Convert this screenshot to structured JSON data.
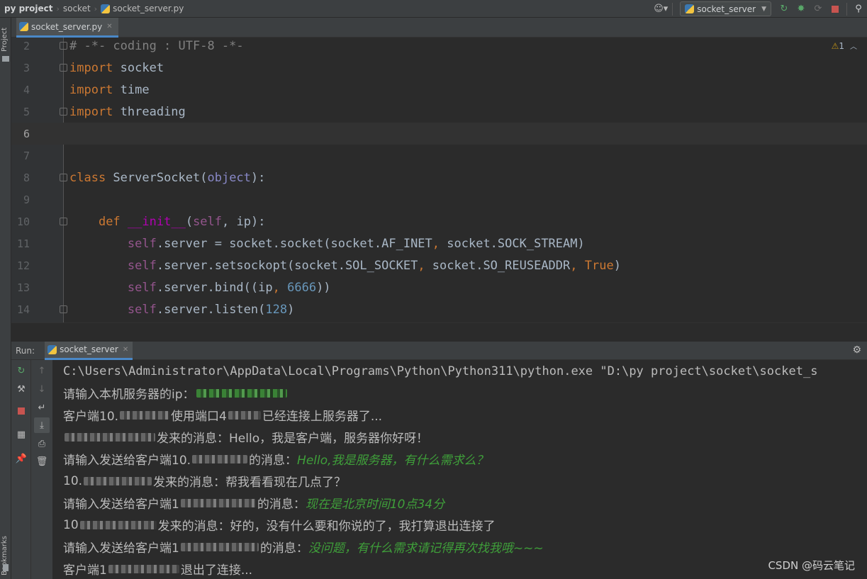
{
  "navbar": {
    "project": "py project",
    "folder": "socket",
    "file": "socket_server.py",
    "run_config": "socket_server"
  },
  "left_strip": {
    "project_tab": "Project",
    "bookmarks_tab": "Bookmarks"
  },
  "editor": {
    "tab_label": "socket_server.py",
    "warning_count": "1",
    "lines": [
      {
        "n": "2",
        "html": "<span class=\"cm\"># -*- coding : UTF-8 -*-</span>"
      },
      {
        "n": "3",
        "html": "<span class=\"kw\">import</span> socket"
      },
      {
        "n": "4",
        "html": "<span class=\"kw\">import</span> time"
      },
      {
        "n": "5",
        "html": "<span class=\"kw\">import</span> threading"
      },
      {
        "n": "6",
        "html": ""
      },
      {
        "n": "7",
        "html": ""
      },
      {
        "n": "8",
        "html": "<span class=\"kw\">class</span> ServerSocket(<span class=\"builtin\">object</span>):"
      },
      {
        "n": "9",
        "html": ""
      },
      {
        "n": "10",
        "html": "    <span class=\"kw\">def</span> <span class=\"magic\">__init__</span>(<span class=\"self\">self</span>, ip):"
      },
      {
        "n": "11",
        "html": "        <span class=\"self\">self</span>.server = socket.socket(socket.AF_INET<span class=\"kw\">,</span> socket.SOCK_STREAM)"
      },
      {
        "n": "12",
        "html": "        <span class=\"self\">self</span>.server.setsockopt(socket.SOL_SOCKET<span class=\"kw\">,</span> socket.SO_REUSEADDR<span class=\"kw\">,</span> <span class=\"kw\">True</span>)"
      },
      {
        "n": "13",
        "html": "        <span class=\"self\">self</span>.server.bind((ip<span class=\"kw\">,</span> <span class=\"num\">6666</span>))"
      },
      {
        "n": "14",
        "html": "        <span class=\"self\">self</span>.server.listen(<span class=\"num\">128</span>)"
      }
    ]
  },
  "run": {
    "label": "Run:",
    "tab": "socket_server"
  },
  "console": {
    "line1": "C:\\Users\\Administrator\\AppData\\Local\\Programs\\Python\\Python311\\python.exe \"D:\\py project\\socket\\socket_s",
    "line2_prompt": "请输入本机服务器的ip：",
    "line3_a": "客户端10.",
    "line3_b": "使用端口4",
    "line3_c": "已经连接上服务器了...",
    "line4_b": "发来的消息：Hello，我是客户端，服务器你好呀！",
    "line5_a": "请输入发送给客户端10.",
    "line5_b": "的消息：",
    "line5_input": "Hello,我是服务器，有什么需求么？",
    "line6_a": "10.",
    "line6_b": "发来的消息：帮我看看现在几点了？",
    "line7_a": "请输入发送给客户端1",
    "line7_b": "的消息：",
    "line7_input": "现在是北京时间10点34分",
    "line8_a": "10",
    "line8_b": "发来的消息：好的，没有什么要和你说的了，我打算退出连接了",
    "line9_a": "请输入发送给客户端1",
    "line9_b": "的消息：",
    "line9_input": "没问题，有什么需求请记得再次找我哦~~~",
    "line10_a": "客户端1",
    "line10_b": "退出了连接..."
  },
  "watermark": "CSDN @码云笔记",
  "colors": {
    "keyword": "#cc7832",
    "self": "#94558d",
    "number": "#6897bb",
    "comment": "#808080",
    "user_input": "#3f9f3a",
    "accent": "#4a88c7"
  }
}
